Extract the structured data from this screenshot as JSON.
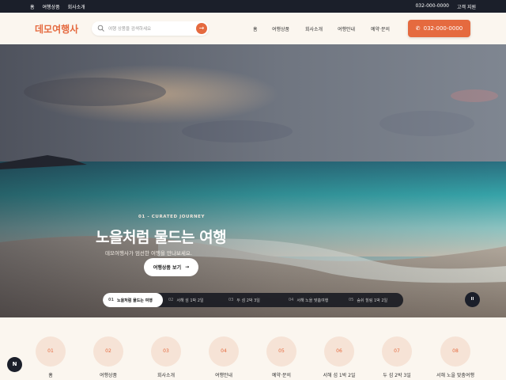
{
  "topbar": {
    "links": [
      "홈",
      "여행상품",
      "회사소개"
    ],
    "phone": "032-000-0000",
    "support": "고객 지원"
  },
  "header": {
    "logo": "데모여행사",
    "search_placeholder": "여행 상품을 검색하세요",
    "nav": [
      "홈",
      "여행상품",
      "회사소개",
      "여행안내",
      "예약·문의"
    ],
    "phone_button": "032-000-0000"
  },
  "hero": {
    "kicker": "01 - CURATED JOURNEY",
    "headline": "노을처럼 물드는 여행",
    "subline": "데모여행사가 엄선한 여행을 만나보세요.",
    "cta": "여행상품 보기",
    "slides": [
      {
        "num": "01",
        "label": "노을처럼 물드는 여행"
      },
      {
        "num": "02",
        "label": "서해 섬 1박 2일"
      },
      {
        "num": "03",
        "label": "두 섬 2박 3일"
      },
      {
        "num": "04",
        "label": "서해 노을 맞춤여행"
      },
      {
        "num": "05",
        "label": "숨쉬 힐링 1박 2일"
      }
    ],
    "pause_label": "II"
  },
  "shortcuts": [
    {
      "num": "01",
      "label": "홈"
    },
    {
      "num": "02",
      "label": "여행상품"
    },
    {
      "num": "03",
      "label": "회사소개"
    },
    {
      "num": "04",
      "label": "여행안내"
    },
    {
      "num": "05",
      "label": "예약·문의"
    },
    {
      "num": "06",
      "label": "서해 섬 1박 2일"
    },
    {
      "num": "07",
      "label": "두 섬 2박 3일"
    },
    {
      "num": "08",
      "label": "서해 노을 맞춤여행"
    }
  ],
  "fab": "N",
  "colors": {
    "accent": "#e56a3f",
    "dark": "#1b1f2a",
    "cream": "#fbf6ef"
  }
}
